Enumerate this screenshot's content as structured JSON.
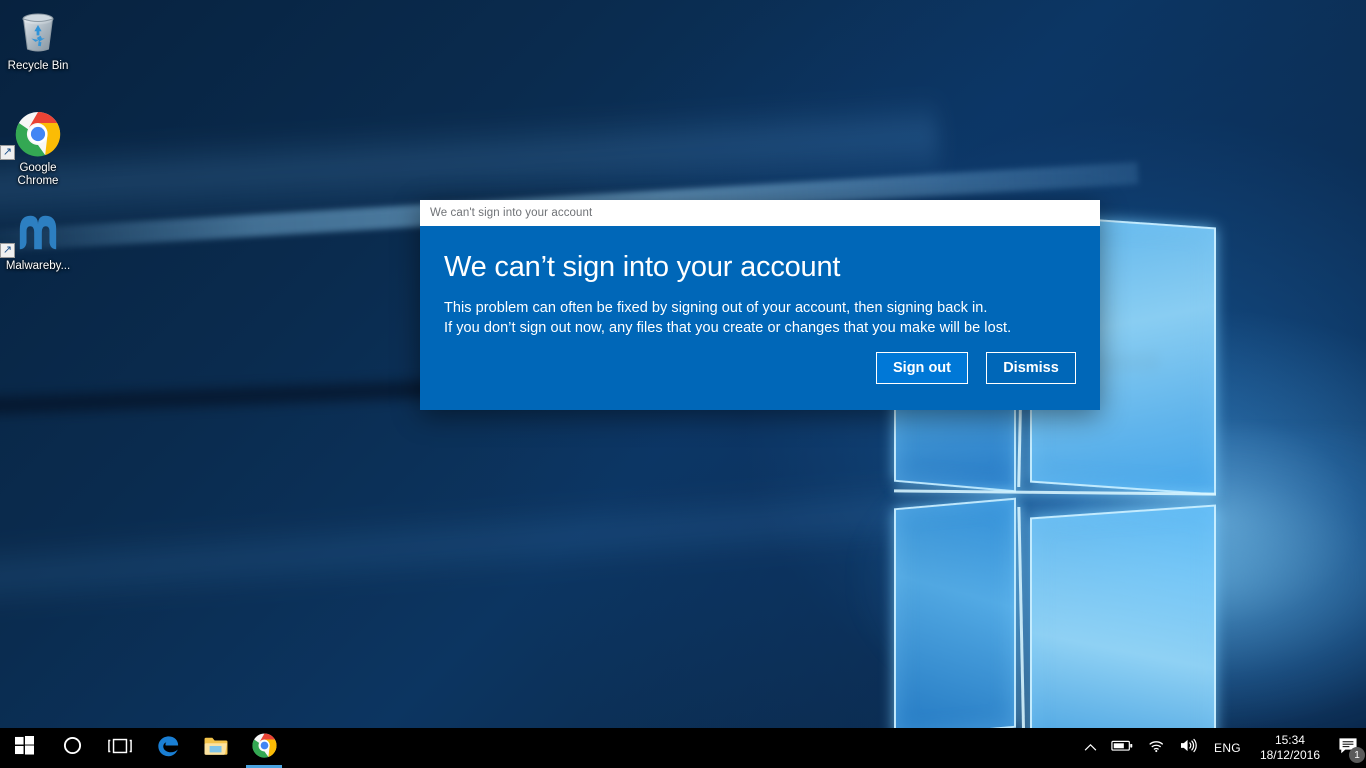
{
  "desktop": {
    "icons": [
      {
        "name": "recycle-bin",
        "label": "Recycle Bin",
        "icon": "recycle-bin-icon",
        "shortcut": false
      },
      {
        "name": "google-chrome",
        "label": "Google Chrome",
        "icon": "chrome-icon",
        "shortcut": true
      },
      {
        "name": "malwarebytes",
        "label": "Malwareby...",
        "icon": "malwarebytes-icon",
        "shortcut": true
      }
    ],
    "wallpaper": "windows-10-hero-logo"
  },
  "dialog": {
    "titlebar": "We can't sign into your account",
    "heading": "We can’t sign into your account",
    "body_line_1": "This problem can often be fixed by signing out of your account, then signing back in.",
    "body_line_2": "If you don’t sign out now, any files that you create or changes that you make will be lost.",
    "buttons": {
      "primary": "Sign out",
      "secondary": "Dismiss"
    },
    "colors": {
      "background": "#0067B8",
      "primary_button": "#0078D7",
      "titlebar": "#FFFFFF",
      "titlebar_text": "#6F7276"
    }
  },
  "taskbar": {
    "buttons": [
      {
        "name": "start-button",
        "icon": "windows-logo-icon"
      },
      {
        "name": "cortana-button",
        "icon": "cortana-circle-icon"
      },
      {
        "name": "task-view-button",
        "icon": "task-view-icon"
      },
      {
        "name": "edge-button",
        "icon": "edge-icon"
      },
      {
        "name": "file-explorer-button",
        "icon": "folder-icon"
      },
      {
        "name": "chrome-taskbar-button",
        "icon": "chrome-icon",
        "active": true
      }
    ],
    "tray": {
      "show_hidden": "show-hidden-icons-chevron",
      "battery": "battery-icon",
      "network": "wifi-icon",
      "volume": "speaker-icon",
      "language": "ENG",
      "time": "15:34",
      "date": "18/12/2016",
      "action_center": "action-center-icon",
      "action_center_badge": "1"
    },
    "accent": "#4AA3E0"
  }
}
